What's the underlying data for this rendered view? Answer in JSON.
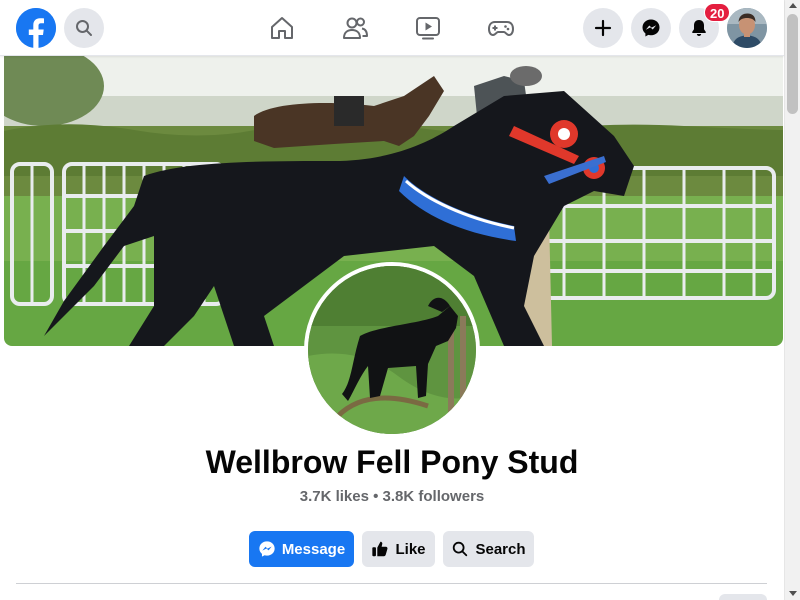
{
  "nav": {
    "logo_icon": "facebook-logo-icon",
    "search_icon": "search-icon",
    "center_icons": [
      "home-icon",
      "friends-icon",
      "watch-icon",
      "gaming-icon"
    ],
    "right_icons": [
      "plus-icon",
      "messenger-icon",
      "bell-icon"
    ],
    "notification_count": "20",
    "brand_color": "#1877f2",
    "badge_color": "#e41e3f"
  },
  "page": {
    "name": "Wellbrow Fell Pony Stud",
    "stats": "3.7K likes • 3.8K followers"
  },
  "actions": {
    "message_label": "Message",
    "like_label": "Like",
    "search_label": "Search"
  }
}
